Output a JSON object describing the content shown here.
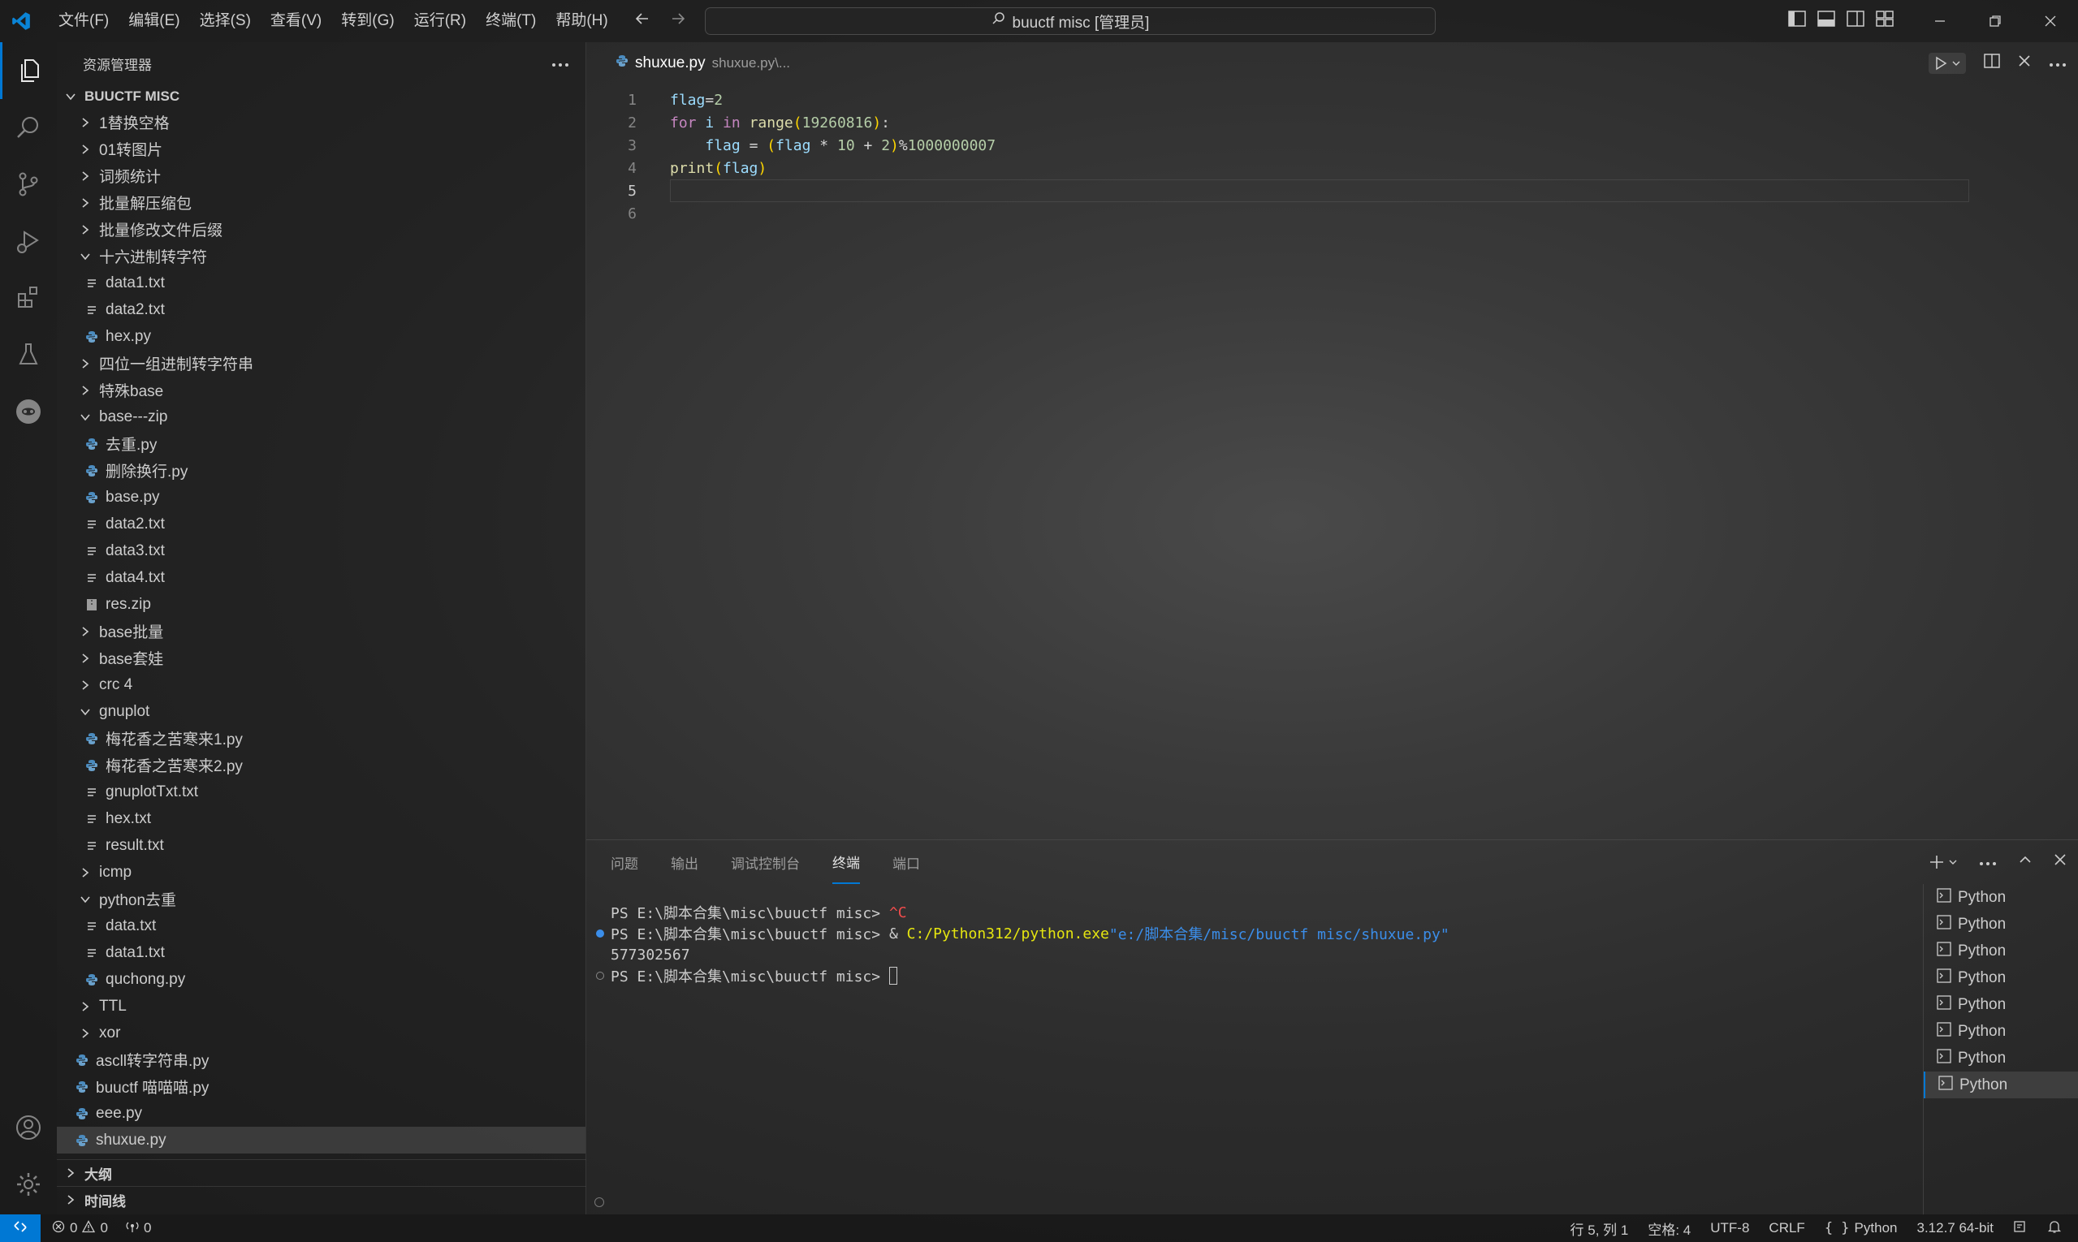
{
  "menu": [
    "文件(F)",
    "编辑(E)",
    "选择(S)",
    "查看(V)",
    "转到(G)",
    "运行(R)",
    "终端(T)",
    "帮助(H)"
  ],
  "command_center": "buuctf misc [管理员]",
  "sidebar": {
    "title": "资源管理器",
    "root": "BUUCTF MISC",
    "tree": [
      {
        "label": "1替换空格",
        "type": "folder",
        "depth": 1,
        "open": false
      },
      {
        "label": "01转图片",
        "type": "folder",
        "depth": 1,
        "open": false
      },
      {
        "label": "词频统计",
        "type": "folder",
        "depth": 1,
        "open": false
      },
      {
        "label": "批量解压缩包",
        "type": "folder",
        "depth": 1,
        "open": false
      },
      {
        "label": "批量修改文件后缀",
        "type": "folder",
        "depth": 1,
        "open": false
      },
      {
        "label": "十六进制转字符",
        "type": "folder",
        "depth": 1,
        "open": true
      },
      {
        "label": "data1.txt",
        "type": "txt",
        "depth": 2
      },
      {
        "label": "data2.txt",
        "type": "txt",
        "depth": 2
      },
      {
        "label": "hex.py",
        "type": "py",
        "depth": 2
      },
      {
        "label": "四位一组进制转字符串",
        "type": "folder",
        "depth": 1,
        "open": false
      },
      {
        "label": "特殊base",
        "type": "folder",
        "depth": 1,
        "open": false
      },
      {
        "label": "base---zip",
        "type": "folder",
        "depth": 1,
        "open": true
      },
      {
        "label": "去重.py",
        "type": "py",
        "depth": 2
      },
      {
        "label": "删除换行.py",
        "type": "py",
        "depth": 2
      },
      {
        "label": "base.py",
        "type": "py",
        "depth": 2
      },
      {
        "label": "data2.txt",
        "type": "txt",
        "depth": 2
      },
      {
        "label": "data3.txt",
        "type": "txt",
        "depth": 2
      },
      {
        "label": "data4.txt",
        "type": "txt",
        "depth": 2
      },
      {
        "label": "res.zip",
        "type": "zip",
        "depth": 2
      },
      {
        "label": "base批量",
        "type": "folder",
        "depth": 1,
        "open": false
      },
      {
        "label": "base套娃",
        "type": "folder",
        "depth": 1,
        "open": false
      },
      {
        "label": "crc 4",
        "type": "folder",
        "depth": 1,
        "open": false
      },
      {
        "label": "gnuplot",
        "type": "folder",
        "depth": 1,
        "open": true
      },
      {
        "label": "梅花香之苦寒来1.py",
        "type": "py",
        "depth": 2
      },
      {
        "label": "梅花香之苦寒来2.py",
        "type": "py",
        "depth": 2
      },
      {
        "label": "gnuplotTxt.txt",
        "type": "txt",
        "depth": 2
      },
      {
        "label": "hex.txt",
        "type": "txt",
        "depth": 2
      },
      {
        "label": "result.txt",
        "type": "txt",
        "depth": 2
      },
      {
        "label": "icmp",
        "type": "folder",
        "depth": 1,
        "open": false
      },
      {
        "label": "python去重",
        "type": "folder",
        "depth": 1,
        "open": true
      },
      {
        "label": "data.txt",
        "type": "txt",
        "depth": 2
      },
      {
        "label": "data1.txt",
        "type": "txt",
        "depth": 2
      },
      {
        "label": "quchong.py",
        "type": "py",
        "depth": 2
      },
      {
        "label": "TTL",
        "type": "folder",
        "depth": 1,
        "open": false
      },
      {
        "label": "xor",
        "type": "folder",
        "depth": 1,
        "open": false
      },
      {
        "label": "ascll转字符串.py",
        "type": "py",
        "depth": 1
      },
      {
        "label": "buuctf 喵喵喵.py",
        "type": "py",
        "depth": 1
      },
      {
        "label": "eee.py",
        "type": "py",
        "depth": 1
      },
      {
        "label": "shuxue.py",
        "type": "py",
        "depth": 1,
        "selected": true
      }
    ],
    "outline": "大纲",
    "timeline": "时间线"
  },
  "editor": {
    "tab_name": "shuxue.py",
    "tab_desc": "shuxue.py\\...",
    "line_numbers": [
      "1",
      "2",
      "3",
      "4",
      "5",
      "6"
    ],
    "current_line": "5"
  },
  "panel": {
    "tabs": [
      "问题",
      "输出",
      "调试控制台",
      "终端",
      "端口"
    ],
    "active_tab": "终端",
    "terminal_lines": {
      "l1_prompt": "PS E:\\脚本合集\\misc\\buuctf misc> ",
      "l1_ctrl": "^C",
      "l2_prompt": "PS E:\\脚本合集\\misc\\buuctf misc> ",
      "l2_amp": "& ",
      "l2_exe": "C:/Python312/python.exe",
      "l2_arg": "\"e:/脚本合集/misc/buuctf misc/shuxue.py\"",
      "l3_output": "577302567",
      "l4_prompt": "PS E:\\脚本合集\\misc\\buuctf misc> "
    },
    "terminals": [
      "Python",
      "Python",
      "Python",
      "Python",
      "Python",
      "Python",
      "Python",
      "Python"
    ]
  },
  "status": {
    "errors": "0",
    "warnings": "0",
    "ports": "0",
    "position": "行 5, 列 1",
    "spaces": "空格: 4",
    "encoding": "UTF-8",
    "eol": "CRLF",
    "language": "Python",
    "interpreter": "3.12.7 64-bit"
  },
  "colors": {
    "accent": "#0078d4",
    "keyword": "#c586c0",
    "function": "#dcdcaa",
    "variable": "#9cdcfe",
    "number": "#b5cea8"
  }
}
